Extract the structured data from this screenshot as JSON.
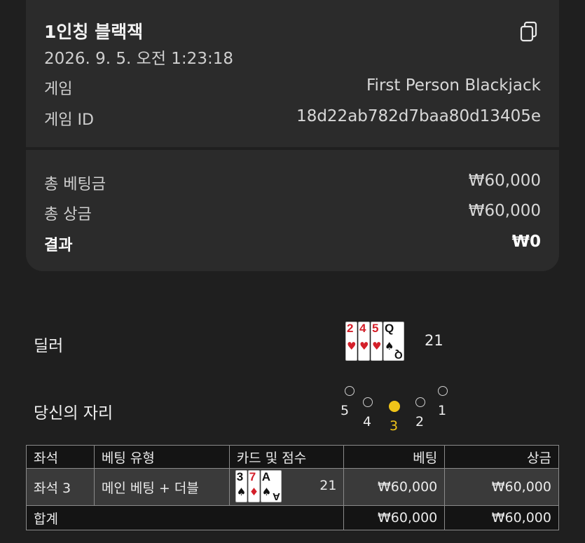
{
  "summary": {
    "title": "1인칭 블랙잭",
    "datetime": "2026. 9. 5. 오전 1:23:18",
    "game_label": "게임",
    "game_value": "First Person Blackjack",
    "game_id_label": "게임 ID",
    "game_id_value": "18d22ab782d7baa80d13405e",
    "total_bet_label": "총 베팅금",
    "total_bet_value": "₩60,000",
    "total_win_label": "총 상금",
    "total_win_value": "₩60,000",
    "result_label": "결과",
    "result_value": "₩0",
    "copy_icon": "copy-icon"
  },
  "dealer": {
    "label": "딜러",
    "cards": [
      {
        "rank": "2",
        "suit": "♥",
        "color": "red"
      },
      {
        "rank": "4",
        "suit": "♥",
        "color": "red"
      },
      {
        "rank": "5",
        "suit": "♥",
        "color": "red"
      },
      {
        "rank": "Q",
        "suit": "♠",
        "color": "black"
      }
    ],
    "score": "21"
  },
  "seats": {
    "label": "당신의 자리",
    "numbers": [
      "5",
      "4",
      "3",
      "2",
      "1"
    ],
    "selected": "3",
    "accent_color": "#f0c419"
  },
  "table": {
    "headers": [
      "좌석",
      "베팅 유형",
      "카드 및 점수",
      "베팅",
      "상금"
    ],
    "rows": [
      {
        "seat": "좌석 3",
        "bet_type": "메인 베팅 + 더블",
        "cards": [
          {
            "rank": "3",
            "suit": "♠",
            "color": "black"
          },
          {
            "rank": "7",
            "suit": "♦",
            "color": "red"
          },
          {
            "rank": "A",
            "suit": "♠",
            "color": "black"
          }
        ],
        "score": "21",
        "bet": "₩60,000",
        "win": "₩60,000"
      }
    ],
    "total_label": "합계",
    "total_bet": "₩60,000",
    "total_win": "₩60,000"
  }
}
